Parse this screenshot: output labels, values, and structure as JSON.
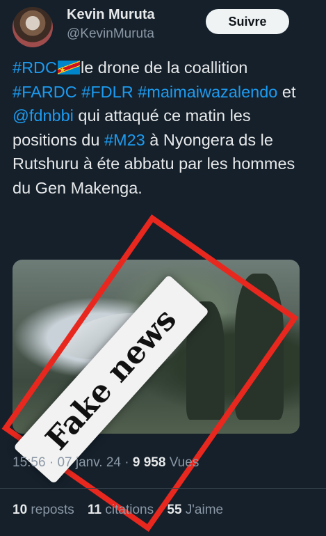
{
  "author": {
    "name": "Kevin Muruta",
    "handle": "@KevinMuruta",
    "follow_label": "Suivre"
  },
  "tweet": {
    "text_parts": [
      {
        "text": "#RDC",
        "tag": true
      },
      {
        "text": "le drone de la coallition ",
        "tag": false
      },
      {
        "text": "#FARDC",
        "tag": true
      },
      {
        "text": " ",
        "tag": false
      },
      {
        "text": "#FDLR",
        "tag": true
      },
      {
        "text": " ",
        "tag": false
      },
      {
        "text": "#maimaiwazalendo",
        "tag": true
      },
      {
        "text": " et ",
        "tag": false
      },
      {
        "text": "@fdnbbi",
        "tag": true
      },
      {
        "text": " qui attaqué ce matin les positions du ",
        "tag": false
      },
      {
        "text": "#M23",
        "tag": true
      },
      {
        "text": " à Nyongera ds le Rutshuru à éte abbatu par les hommes du Gen Makenga.",
        "tag": false
      }
    ]
  },
  "overlay": {
    "stamp_text": "Fake news",
    "frame_color": "#e8281f"
  },
  "meta": {
    "time": "15:56",
    "date": "07 janv. 24",
    "views_count": "9 958",
    "views_label": "Vues"
  },
  "stats": {
    "reposts_count": "10",
    "reposts_label": "reposts",
    "quotes_count": "11",
    "quotes_label": "citations",
    "likes_count": "55",
    "likes_label": "J'aime"
  },
  "colors": {
    "background": "#15202b",
    "link": "#1d9bf0",
    "muted": "#8b98a5"
  }
}
